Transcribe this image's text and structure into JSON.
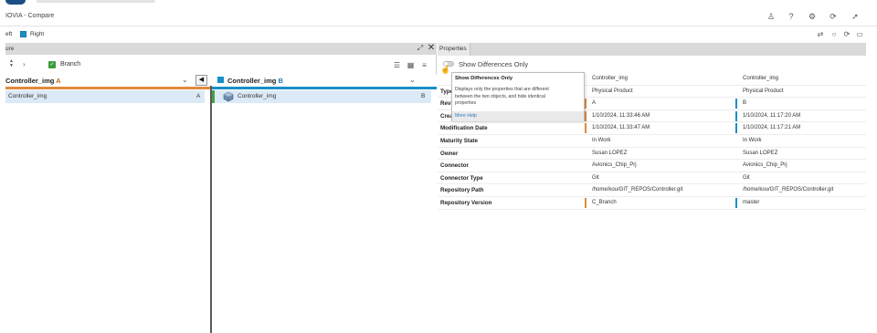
{
  "app": {
    "title": "IOVIA - Compare"
  },
  "toolbar_icons": [
    "user-share-icon",
    "help-icon",
    "gear-icon",
    "refresh-icon",
    "pin-icon"
  ],
  "legend": {
    "left_label": "eft",
    "right_label": "Right",
    "right_color": "#1a8fc7",
    "left_color": "#e08a3c"
  },
  "structure": {
    "title": "ure",
    "branch_label": "Branch",
    "left": {
      "name": "Controller_img",
      "side": "A",
      "rows": [
        {
          "name": "Controller_img",
          "tag": "A"
        }
      ]
    },
    "right": {
      "name": "Controller_img",
      "side": "B",
      "rows": [
        {
          "name": "Controller_img",
          "tag": "B"
        }
      ]
    },
    "match_color": "#47a147"
  },
  "properties": {
    "tab_label": "Properties",
    "show_differences_label": "Show Differences Only",
    "show_differences_on": false,
    "rows": [
      {
        "name": "",
        "left": "Controller_img",
        "right": "Controller_img",
        "diff": false
      },
      {
        "name": "Type",
        "left": "Physical Product",
        "right": "Physical Product",
        "diff": false
      },
      {
        "name": "Revision",
        "left": "A",
        "right": "B",
        "diff": true
      },
      {
        "name": "Creation Date",
        "left": "1/10/2024, 11:33:46 AM",
        "right": "1/10/2024, 11:17:20 AM",
        "diff": true
      },
      {
        "name": "Modification Date",
        "left": "1/10/2024, 11:33:47 AM",
        "right": "1/10/2024, 11:17:21 AM",
        "diff": true
      },
      {
        "name": "Maturity State",
        "left": "In Work",
        "right": "In Work",
        "diff": false
      },
      {
        "name": "Owner",
        "left": "Susan LOPEZ",
        "right": "Susan LOPEZ",
        "diff": false
      },
      {
        "name": "Connector",
        "left": "Avionics_Chip_Prj",
        "right": "Avionics_Chip_Prj",
        "diff": false
      },
      {
        "name": "Connector Type",
        "left": "Git",
        "right": "Git",
        "diff": false
      },
      {
        "name": "Repository Path",
        "left": "/home/kou/GIT_REPOS/Controller.git",
        "right": "/home/kou/GIT_REPOS/Controller.git",
        "diff": false
      },
      {
        "name": "Repository Version",
        "left": "C_Branch",
        "right": "master",
        "diff": true
      }
    ]
  },
  "tooltip": {
    "title": "Show Differences Only",
    "body": "Displays only the properties that are different between the two objects, and hide identical properties",
    "link": "More Help"
  }
}
